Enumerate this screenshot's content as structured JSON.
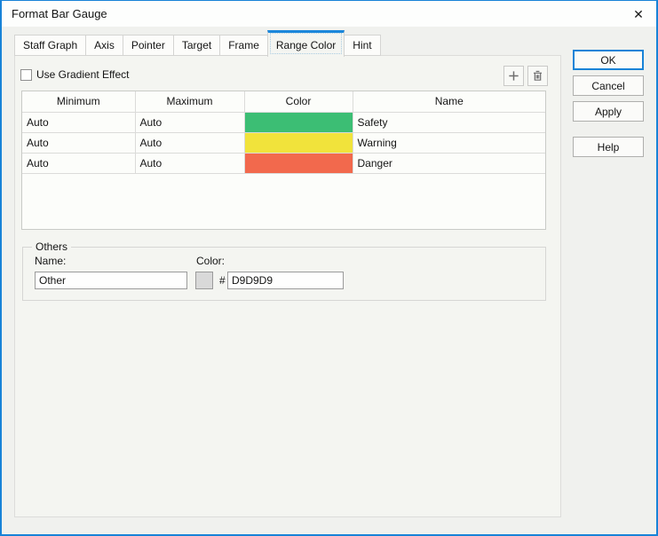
{
  "window": {
    "title": "Format Bar Gauge",
    "close_symbol": "✕"
  },
  "tabs": [
    "Staff Graph",
    "Axis",
    "Pointer",
    "Target",
    "Frame",
    "Range Color",
    "Hint"
  ],
  "active_tab": "Range Color",
  "panel": {
    "gradient_checkbox": {
      "label": "Use Gradient Effect",
      "checked": false
    },
    "range_table": {
      "columns": [
        "Minimum",
        "Maximum",
        "Color",
        "Name"
      ],
      "rows": [
        {
          "minimum": "Auto",
          "maximum": "Auto",
          "color": "#3CBE74",
          "name": "Safety"
        },
        {
          "minimum": "Auto",
          "maximum": "Auto",
          "color": "#F1E33B",
          "name": "Warning"
        },
        {
          "minimum": "Auto",
          "maximum": "Auto",
          "color": "#F2694D",
          "name": "Danger"
        }
      ]
    },
    "others": {
      "group_label": "Others",
      "name_label": "Name:",
      "name_value": "Other",
      "color_label": "Color:",
      "hash_symbol": "#",
      "color_value": "D9D9D9",
      "swatch_color": "#D9D9D9"
    }
  },
  "action_buttons": {
    "ok": "OK",
    "cancel": "Cancel",
    "apply": "Apply",
    "help": "Help"
  },
  "colors": {
    "accent": "#1883D7"
  }
}
